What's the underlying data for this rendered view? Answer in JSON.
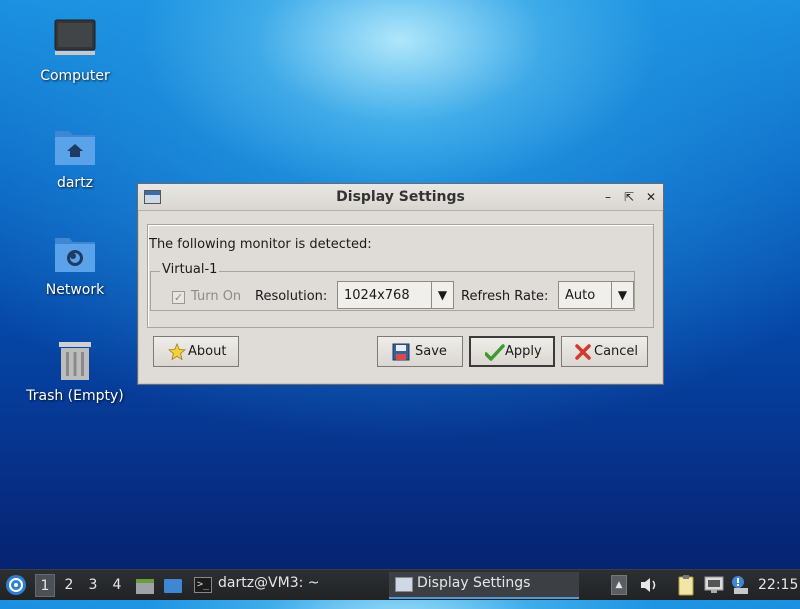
{
  "desktop": {
    "icons": [
      {
        "label": "Computer",
        "icon": "monitor-icon"
      },
      {
        "label": "dartz",
        "icon": "home-folder-icon"
      },
      {
        "label": "Network",
        "icon": "network-folder-icon"
      },
      {
        "label": "Trash (Empty)",
        "icon": "trash-icon"
      }
    ]
  },
  "dialog": {
    "title": "Display Settings",
    "detected_text": "The following monitor is detected:",
    "monitor_name": "Virtual-1",
    "turn_on_label": "Turn On",
    "turn_on_checked": true,
    "resolution_label": "Resolution:",
    "resolution_value": "1024x768",
    "refresh_label": "Refresh Rate:",
    "refresh_value": "Auto",
    "buttons": {
      "about": "About",
      "save": "Save",
      "apply": "Apply",
      "cancel": "Cancel"
    }
  },
  "taskbar": {
    "workspaces": [
      "1",
      "2",
      "3",
      "4"
    ],
    "active_workspace": "1",
    "terminal_task": "dartz@VM3: ~",
    "active_task": "Display Settings",
    "clock": "22:15"
  },
  "colors": {
    "accent": "#4f9ad8",
    "dialog_bg": "#dfdcd7",
    "taskbar_bg": "#2d3033"
  }
}
